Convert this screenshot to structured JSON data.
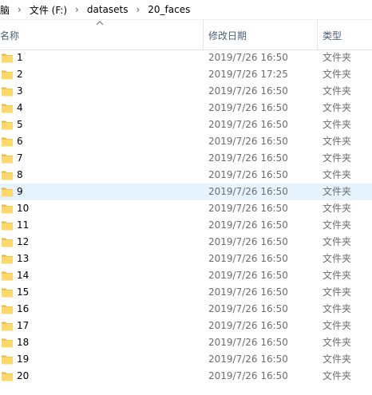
{
  "breadcrumb": {
    "items": [
      "脑",
      "文件 (F:)",
      "datasets",
      "20_faces"
    ],
    "separator": "›"
  },
  "columns": {
    "name": "名称",
    "date": "修改日期",
    "type": "类型",
    "sort_icon": "chevron-up-icon"
  },
  "files": [
    {
      "name": "1",
      "date": "2019/7/26 16:50",
      "type": "文件夹"
    },
    {
      "name": "2",
      "date": "2019/7/26 17:25",
      "type": "文件夹"
    },
    {
      "name": "3",
      "date": "2019/7/26 16:50",
      "type": "文件夹"
    },
    {
      "name": "4",
      "date": "2019/7/26 16:50",
      "type": "文件夹"
    },
    {
      "name": "5",
      "date": "2019/7/26 16:50",
      "type": "文件夹"
    },
    {
      "name": "6",
      "date": "2019/7/26 16:50",
      "type": "文件夹"
    },
    {
      "name": "7",
      "date": "2019/7/26 16:50",
      "type": "文件夹"
    },
    {
      "name": "8",
      "date": "2019/7/26 16:50",
      "type": "文件夹"
    },
    {
      "name": "9",
      "date": "2019/7/26 16:50",
      "type": "文件夹",
      "selected": true
    },
    {
      "name": "10",
      "date": "2019/7/26 16:50",
      "type": "文件夹"
    },
    {
      "name": "11",
      "date": "2019/7/26 16:50",
      "type": "文件夹"
    },
    {
      "name": "12",
      "date": "2019/7/26 16:50",
      "type": "文件夹"
    },
    {
      "name": "13",
      "date": "2019/7/26 16:50",
      "type": "文件夹"
    },
    {
      "name": "14",
      "date": "2019/7/26 16:50",
      "type": "文件夹"
    },
    {
      "name": "15",
      "date": "2019/7/26 16:50",
      "type": "文件夹"
    },
    {
      "name": "16",
      "date": "2019/7/26 16:50",
      "type": "文件夹"
    },
    {
      "name": "17",
      "date": "2019/7/26 16:50",
      "type": "文件夹"
    },
    {
      "name": "18",
      "date": "2019/7/26 16:50",
      "type": "文件夹"
    },
    {
      "name": "19",
      "date": "2019/7/26 16:50",
      "type": "文件夹"
    },
    {
      "name": "20",
      "date": "2019/7/26 16:50",
      "type": "文件夹"
    }
  ],
  "colors": {
    "folder_fill": "#ffd86a",
    "folder_tab": "#e8b43f",
    "selected_row": "#e5f3ff",
    "header_text": "#4c607a"
  },
  "icons": {
    "folder": "folder-icon"
  }
}
